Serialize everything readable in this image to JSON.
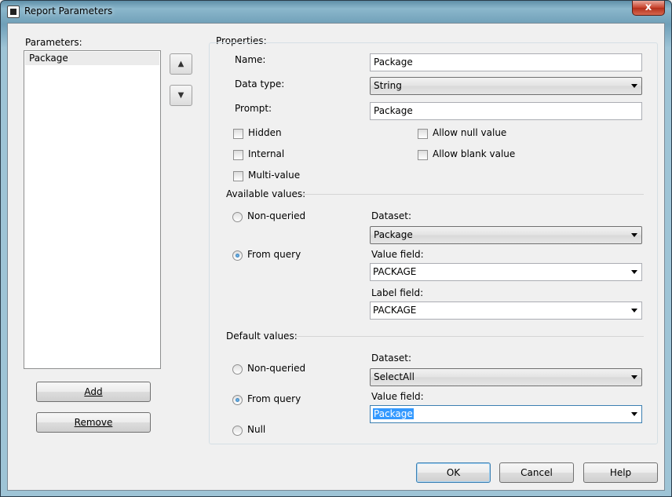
{
  "window": {
    "title": "Report Parameters",
    "close_glyph": "x"
  },
  "left": {
    "parameters_label": "Parameters:",
    "items": [
      "Package"
    ],
    "add_label": "Add",
    "remove_label": "Remove"
  },
  "properties": {
    "section_label": "Properties:",
    "name_label": "Name:",
    "name_value": "Package",
    "datatype_label": "Data type:",
    "datatype_value": "String",
    "prompt_label": "Prompt:",
    "prompt_value": "Package",
    "hidden_label": "Hidden",
    "internal_label": "Internal",
    "multivalue_label": "Multi-value",
    "allow_null_label": "Allow null value",
    "allow_blank_label": "Allow blank value",
    "hidden_checked": false,
    "internal_checked": false,
    "multivalue_checked": false,
    "allow_null_checked": false,
    "allow_blank_checked": false
  },
  "available": {
    "section_label": "Available values:",
    "nonqueried_label": "Non-queried",
    "fromquery_label": "From query",
    "selected": "From query",
    "dataset_label": "Dataset:",
    "dataset_value": "Package",
    "valuefield_label": "Value field:",
    "valuefield_value": "PACKAGE",
    "labelfield_label": "Label field:",
    "labelfield_value": "PACKAGE"
  },
  "defaults": {
    "section_label": "Default values:",
    "nonqueried_label": "Non-queried",
    "fromquery_label": "From query",
    "null_label": "Null",
    "selected": "From query",
    "dataset_label": "Dataset:",
    "dataset_value": "SelectAll",
    "valuefield_label": "Value field:",
    "valuefield_value": "Package"
  },
  "footer": {
    "ok_label": "OK",
    "cancel_label": "Cancel",
    "help_label": "Help"
  },
  "icons": {
    "move_up": "arrow-up-icon",
    "move_down": "arrow-down-icon"
  },
  "colors": {
    "selection": "#3399ff",
    "close_button": "#c7402a"
  }
}
